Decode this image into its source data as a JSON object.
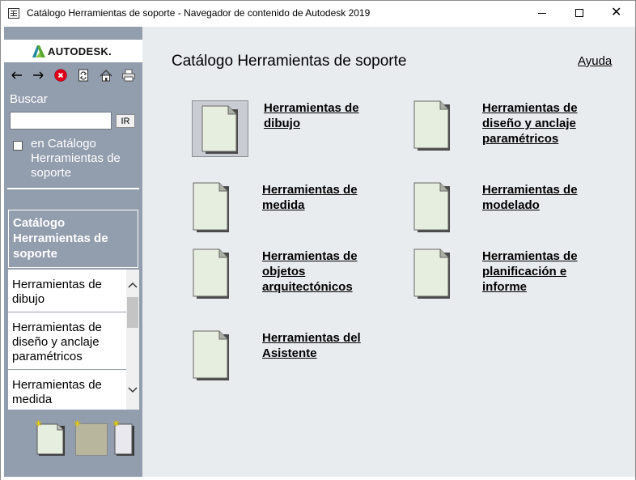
{
  "window": {
    "title": "Catálogo Herramientas de soporte - Navegador de contenido de Autodesk 2019",
    "controls": [
      "minimize-icon",
      "maximize-icon",
      "close-icon"
    ],
    "close_glyph": "✕"
  },
  "sidebar": {
    "brand": "AUTODESK.",
    "nav_icons": [
      "back-arrow-icon",
      "forward-arrow-icon",
      "stop-icon",
      "refresh-icon",
      "home-icon",
      "print-icon"
    ],
    "search_label": "Buscar",
    "search_value": "",
    "search_button": "IR",
    "scope_checked": false,
    "scope_label": "en Catálogo Herramientas de soporte",
    "catalog_title": "Catálogo Herramientas de soporte",
    "items": [
      {
        "label": "Herramientas de dibujo"
      },
      {
        "label": "Herramientas de diseño y anclaje paramétricos"
      },
      {
        "label": "Herramientas de medida"
      }
    ],
    "view_buttons": [
      "page-view-icon",
      "tile-view-icon",
      "slim-view-icon"
    ]
  },
  "main": {
    "title": "Catálogo Herramientas de soporte",
    "help": "Ayuda",
    "categories": [
      {
        "label": "Herramientas de dibujo",
        "selected": true
      },
      {
        "label": "Herramientas de diseño y anclaje paramétricos",
        "selected": false
      },
      {
        "label": "Herramientas de medida",
        "selected": false
      },
      {
        "label": "Herramientas de modelado",
        "selected": false
      },
      {
        "label": "Herramientas de objetos arquitectónicos",
        "selected": false
      },
      {
        "label": "Herramientas de planificación e informe",
        "selected": false
      },
      {
        "label": "Herramientas del Asistente",
        "selected": false
      }
    ]
  },
  "colors": {
    "sidebar_bg": "#929dae",
    "main_bg": "#e9ecef",
    "doc_fill": "#e6eedf",
    "stop_red": "#e0001a",
    "brand_green": "#5aa832",
    "brand_teal": "#1f8a9c"
  }
}
